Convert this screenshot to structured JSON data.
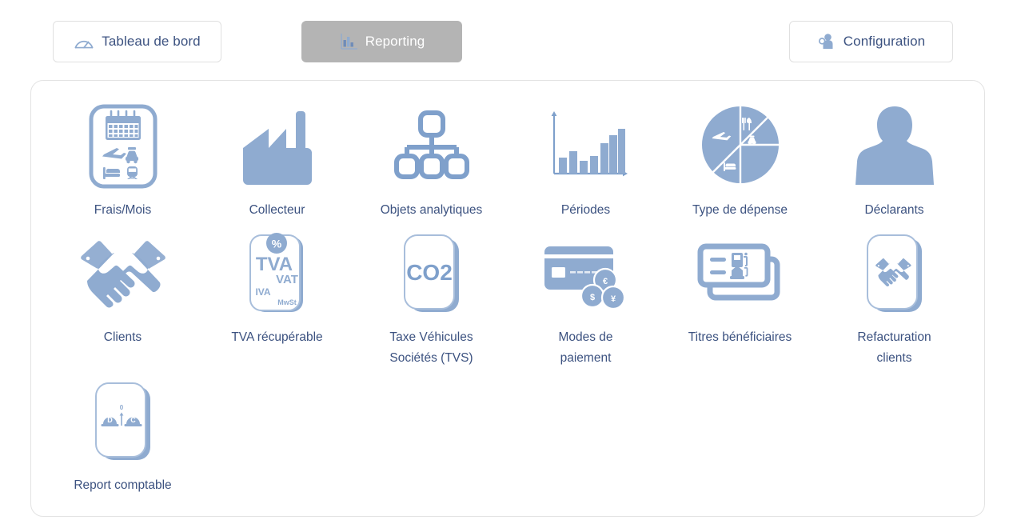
{
  "theme": {
    "icon_blue": "#8fabd0",
    "label_color": "#3c5280",
    "active_tab_bg": "#b4b4b4",
    "panel_border": "#e3e3e3",
    "page_bg": "#ffffff"
  },
  "nav": {
    "dashboard": {
      "label": "Tableau de bord",
      "icon": "gauge-icon",
      "active": false
    },
    "reporting": {
      "label": "Reporting",
      "icon": "bar-chart-icon",
      "active": true
    },
    "configuration": {
      "label": "Configuration",
      "icon": "user-gear-icon",
      "active": false
    }
  },
  "tiles": [
    {
      "label": "Frais/Mois",
      "icon": "calendar-travel-card-icon"
    },
    {
      "label": "Collecteur",
      "icon": "factory-icon"
    },
    {
      "label": "Objets analytiques",
      "icon": "org-tree-icon"
    },
    {
      "label": "Périodes",
      "icon": "bar-chart-axes-icon"
    },
    {
      "label": "Type de dépense",
      "icon": "pie-chart-expense-icon"
    },
    {
      "label": "Déclarants",
      "icon": "person-silhouette-icon"
    },
    {
      "label": "Clients",
      "icon": "handshake-icon"
    },
    {
      "label": "TVA récupérable",
      "icon": "vat-card-icon"
    },
    {
      "label": "Taxe Véhicules\nSociétés (TVS)",
      "icon": "co2-card-icon"
    },
    {
      "label": "Modes de\npaiement",
      "icon": "credit-card-coins-icon"
    },
    {
      "label": "Titres bénéficiaires",
      "icon": "voucher-cards-icon"
    },
    {
      "label": "Refacturation\nclients",
      "icon": "handshake-card-icon"
    },
    {
      "label": "Report comptable",
      "icon": "debit-credit-balance-card-icon"
    }
  ],
  "vat_card": {
    "primary": "TVA",
    "secondary": "VAT",
    "tertiary": "IVA",
    "quaternary": "MwSt",
    "badge": "%"
  },
  "co2_card": {
    "text": "CO2"
  },
  "coins": {
    "euro": "€",
    "dollar": "$",
    "yen": "¥"
  },
  "balance_card": {
    "debit": "D",
    "credit": "C",
    "zero": "0"
  }
}
